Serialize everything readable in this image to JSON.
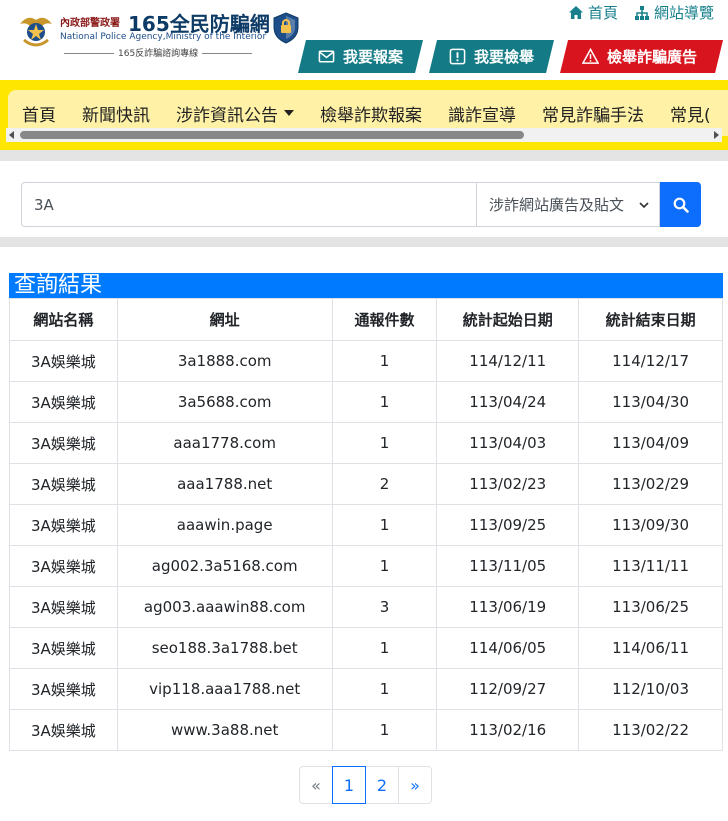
{
  "header": {
    "agency": "內政部警政署",
    "brand": "165全民防騙網",
    "english": "National Police Agency,Ministry of the Interior",
    "tagline": "165反詐騙諮詢專線",
    "top_links": {
      "home": "首頁",
      "sitemap": "網站導覽"
    },
    "actions": {
      "report": "我要報案",
      "tipoff": "我要檢舉",
      "ad_report": "檢舉詐騙廣告"
    }
  },
  "nav": {
    "items": [
      "首頁",
      "新聞快訊",
      "涉詐資訊公告",
      "檢舉詐欺報案",
      "識詐宣導",
      "常見詐騙手法",
      "常見("
    ]
  },
  "search": {
    "query": "3A",
    "category": "涉詐網站廣告及貼文"
  },
  "results": {
    "title": "查詢結果",
    "columns": [
      "網站名稱",
      "網址",
      "通報件數",
      "統計起始日期",
      "統計結束日期"
    ],
    "rows": [
      [
        "3A娛樂城",
        "3a1888.com",
        "1",
        "114/12/11",
        "114/12/17"
      ],
      [
        "3A娛樂城",
        "3a5688.com",
        "1",
        "113/04/24",
        "113/04/30"
      ],
      [
        "3A娛樂城",
        "aaa1778.com",
        "1",
        "113/04/03",
        "113/04/09"
      ],
      [
        "3A娛樂城",
        "aaa1788.net",
        "2",
        "113/02/23",
        "113/02/29"
      ],
      [
        "3A娛樂城",
        "aaawin.page",
        "1",
        "113/09/25",
        "113/09/30"
      ],
      [
        "3A娛樂城",
        "ag002.3a5168.com",
        "1",
        "113/11/05",
        "113/11/11"
      ],
      [
        "3A娛樂城",
        "ag003.aaawin88.com",
        "3",
        "113/06/19",
        "113/06/25"
      ],
      [
        "3A娛樂城",
        "seo188.3a1788.bet",
        "1",
        "114/06/05",
        "114/06/11"
      ],
      [
        "3A娛樂城",
        "vip118.aaa1788.net",
        "1",
        "112/09/27",
        "112/10/03"
      ],
      [
        "3A娛樂城",
        "www.3a88.net",
        "1",
        "113/02/16",
        "113/02/22"
      ]
    ]
  },
  "pagination": {
    "prev": "«",
    "pages": [
      "1",
      "2"
    ],
    "next": "»",
    "current": "1"
  },
  "colors": {
    "teal": "#147b86",
    "red": "#d8141e",
    "yellow": "#ffe600",
    "primary": "#0d6efd"
  }
}
